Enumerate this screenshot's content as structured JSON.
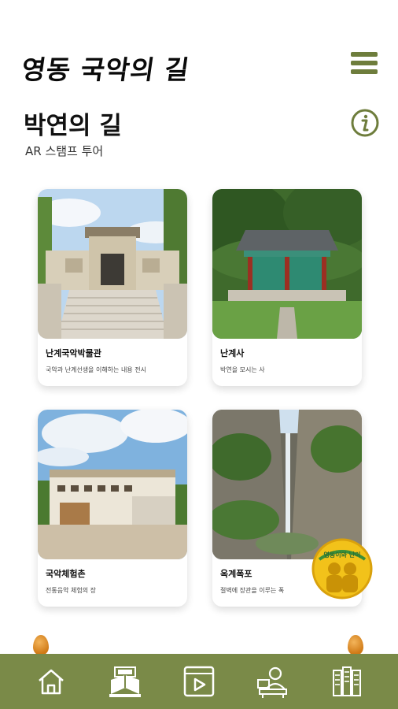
{
  "header": {
    "app_title": "영동 국악의 길",
    "menu_icon": "hamburger-icon"
  },
  "page": {
    "title": "박연의 길",
    "subtitle": "AR 스탬프 투어",
    "info_icon": "info-icon"
  },
  "cards": [
    {
      "name": "난계국악박물관",
      "desc": "국악과 난계선생을 이해하는 내용 전시",
      "image": "museum-photo"
    },
    {
      "name": "난계사",
      "desc": "박연을 모시는 사",
      "image": "shrine-photo"
    },
    {
      "name": "국악체험촌",
      "desc": "전통음악 체험의 장",
      "image": "experience-village-photo"
    },
    {
      "name": "옥계폭포",
      "desc": "절벽에 장관을 이루는 폭",
      "image": "waterfall-photo"
    }
  ],
  "badge": {
    "text": "영동이와 난이",
    "icon": "mascot-badge-icon"
  },
  "bottom_nav": [
    {
      "icon": "home-icon"
    },
    {
      "icon": "book-icon"
    },
    {
      "icon": "video-icon"
    },
    {
      "icon": "guide-icon"
    },
    {
      "icon": "library-icon"
    }
  ],
  "colors": {
    "accent": "#7a8a48",
    "menu": "#6e7d3c",
    "egg": "#d9861f"
  }
}
